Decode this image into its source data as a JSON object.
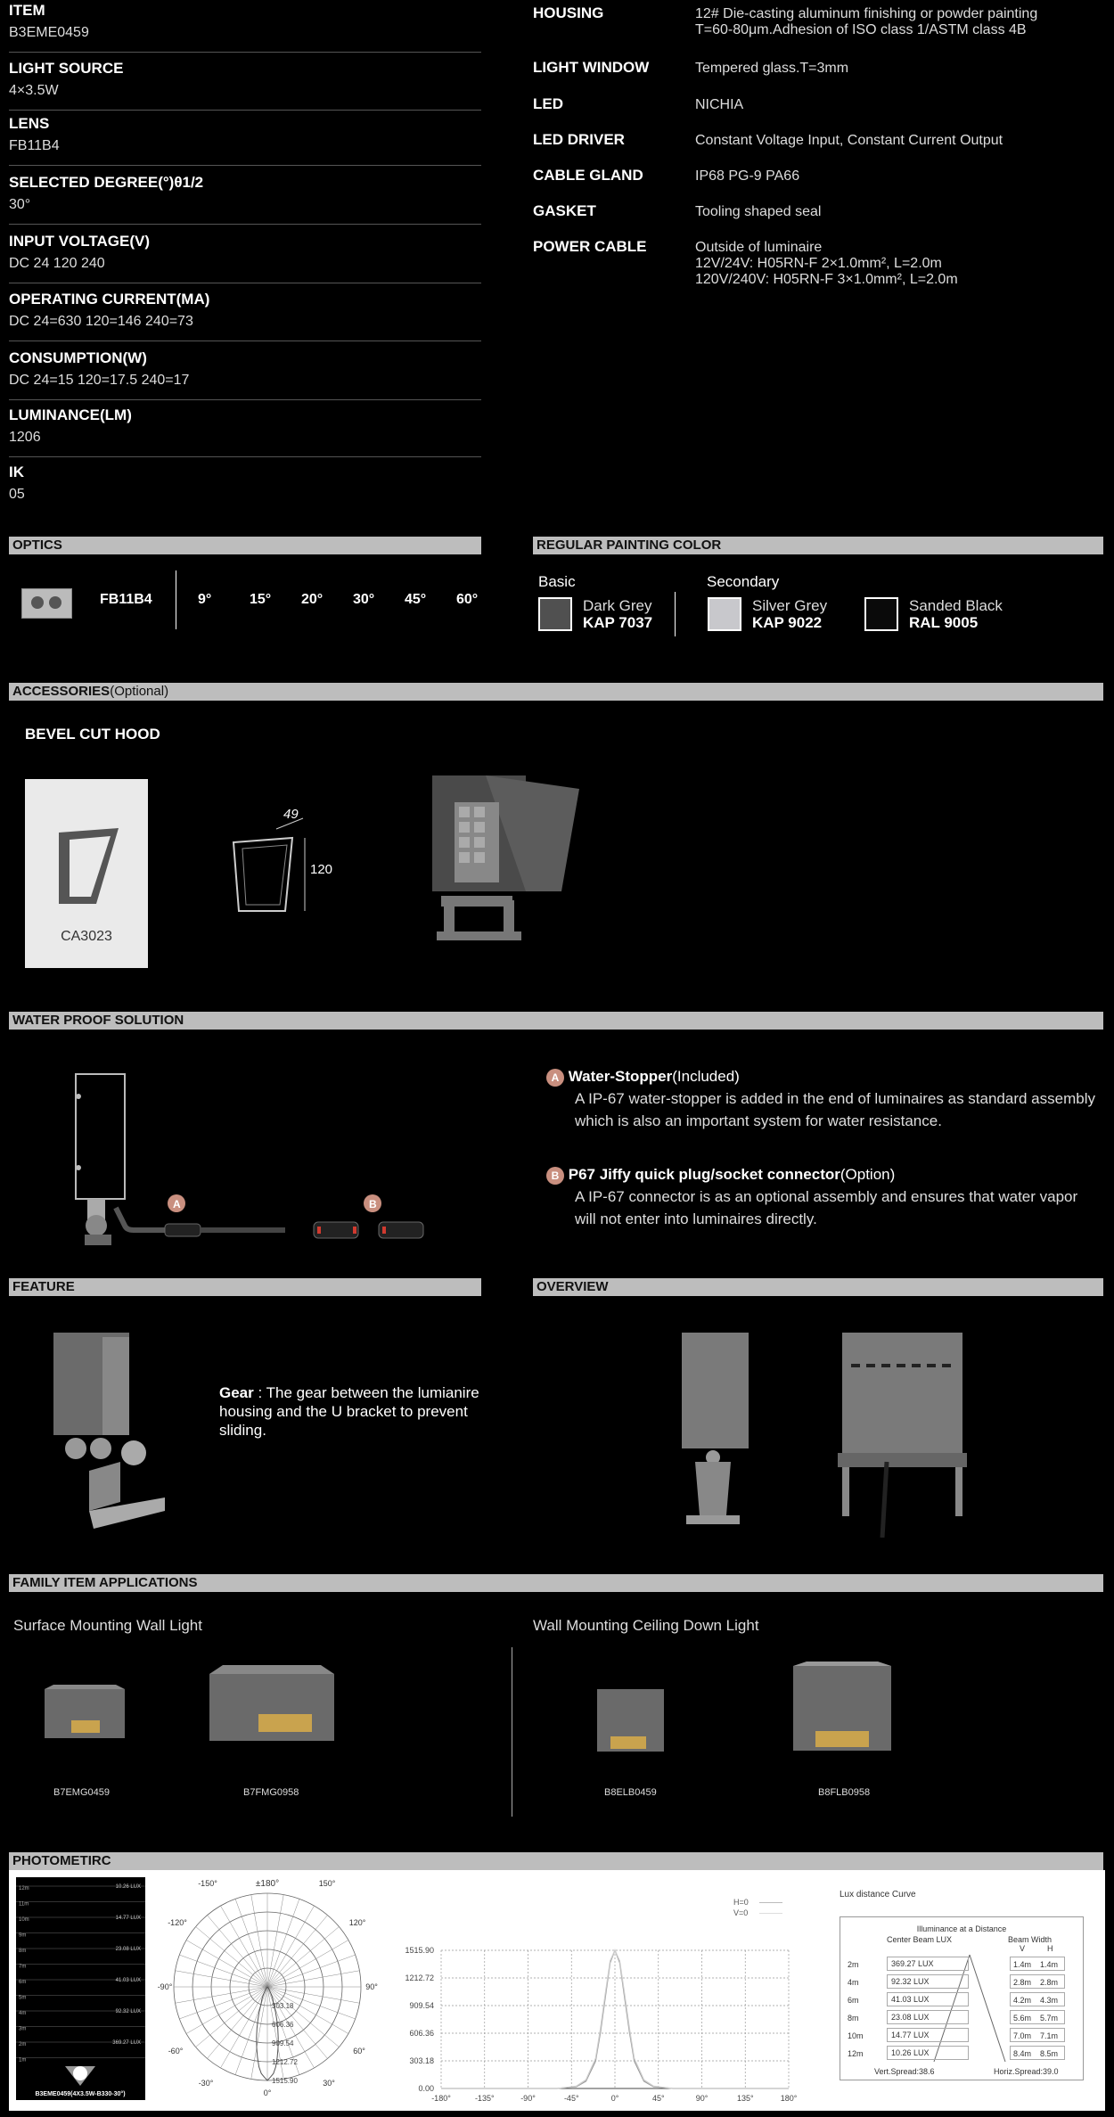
{
  "specs_left": [
    {
      "label": "ITEM",
      "value": "B3EME0459"
    },
    {
      "label": "LIGHT SOURCE",
      "value": "4×3.5W"
    },
    {
      "label": "LENS",
      "value": "FB11B4"
    },
    {
      "label": "SELECTED DEGREE(°)θ1/2",
      "value": "30°"
    },
    {
      "label": "INPUT VOLTAGE(V)",
      "value": "DC 24  120  240"
    },
    {
      "label": "OPERATING CURRENT(MA)",
      "value": "DC 24=630  120=146  240=73"
    },
    {
      "label": "CONSUMPTION(W)",
      "value": "DC 24=15  120=17.5  240=17"
    },
    {
      "label": "LUMINANCE(LM)",
      "value": "1206"
    },
    {
      "label": "IK",
      "value": "05"
    }
  ],
  "specs_right": [
    {
      "label": "HOUSING",
      "value": "12# Die-casting aluminum finishing or powder painting\nT=60-80μm.Adhesion of ISO class 1/ASTM class 4B"
    },
    {
      "label": "LIGHT WINDOW",
      "value": "Tempered glass.T=3mm"
    },
    {
      "label": "LED",
      "value": "NICHIA"
    },
    {
      "label": "LED DRIVER",
      "value": "Constant Voltage Input, Constant Current Output"
    },
    {
      "label": "CABLE GLAND",
      "value": "IP68 PG-9 PA66"
    },
    {
      "label": "GASKET",
      "value": "Tooling shaped seal"
    },
    {
      "label": "POWER CABLE",
      "value": "Outside of luminaire\n12V/24V: H05RN-F 2×1.0mm², L=2.0m\n120V/240V: H05RN-F 3×1.0mm², L=2.0m"
    }
  ],
  "optics": {
    "title": "OPTICS",
    "lens": "FB11B4",
    "degrees": [
      "9°",
      "15°",
      "20°",
      "30°",
      "45°",
      "60°"
    ]
  },
  "painting": {
    "title": "REGULAR PAINTING COLOR",
    "basic_label": "Basic",
    "secondary_label": "Secondary",
    "colors": [
      {
        "name": "Dark Grey",
        "code": "KAP 7037",
        "hex": "#505050"
      },
      {
        "name": "Silver Grey",
        "code": "KAP 9022",
        "hex": "#c8c8cc"
      },
      {
        "name": "Sanded Black",
        "code": "RAL 9005",
        "hex": "#0a0a0a"
      }
    ]
  },
  "accessories": {
    "title": "ACCESSORIES",
    "title_suffix": "(Optional)",
    "item_title": "BEVEL CUT HOOD",
    "code": "CA3023",
    "dim_width": "49",
    "dim_height": "120"
  },
  "waterproof": {
    "title": "WATER PROOF SOLUTION",
    "a_letter": "A",
    "a_title": "Water-Stopper",
    "a_suffix": "(Included)",
    "a_text": "A IP-67 water-stopper is added in the end of luminaires as standard assembly which is also an important system for water resistance.",
    "b_letter": "B",
    "b_title": "P67 Jiffy quick plug/socket connector",
    "b_suffix": "(Option)",
    "b_text": "A IP-67 connector is as an optional assembly and ensures that water vapor will not enter into luminaires directly."
  },
  "feature": {
    "title": "FEATURE",
    "gear_title": "Gear",
    "gear_text": " : The gear between the lumianire housing and the U bracket to prevent sliding."
  },
  "overview": {
    "title": "OVERVIEW"
  },
  "family": {
    "title": "FAMILY ITEM APPLICATIONS",
    "left_title": "Surface Mounting Wall Light",
    "right_title": "Wall Mounting Ceiling Down Light",
    "items": [
      "B7EMG0459",
      "B7FMG0958",
      "B8ELB0459",
      "B8FLB0958"
    ]
  },
  "photometric": {
    "title": "PHOTOMETIRC",
    "dist_rows": [
      "12m",
      "11m",
      "10m",
      "9m",
      "8m",
      "7m",
      "6m",
      "5m",
      "4m",
      "3m",
      "2m",
      "1m"
    ],
    "dist_lux": [
      "10.26 LUX",
      "14.77 LUX",
      "23.08 LUX",
      "41.03 LUX",
      "92.32 LUX",
      "369.27 LUX"
    ],
    "dist_caption": "B3EME0459(4X3.5W-B330-30°)",
    "polar_top": "±180°",
    "polar_angles": [
      "-150°",
      "150°",
      "-120°",
      "120°",
      "-90°",
      "90°",
      "-60°",
      "60°",
      "-30°",
      "30°",
      "0°"
    ],
    "polar_values": [
      "303.18",
      "606.36",
      "909.54",
      "1212.72",
      "1515.90"
    ],
    "legend_h": "H=0",
    "legend_v": "V=0",
    "lux_curve_title": "Lux distance Curve",
    "illum_title": "Illuminance at a Distance",
    "illum_center": "Center Beam LUX",
    "illum_beam": "Beam Width",
    "illum_v": "V",
    "illum_h": "H",
    "illum_rows": [
      {
        "d": "2m",
        "lux": "369.27 LUX",
        "v": "1.4m",
        "h": "1.4m"
      },
      {
        "d": "4m",
        "lux": "92.32 LUX",
        "v": "2.8m",
        "h": "2.8m"
      },
      {
        "d": "6m",
        "lux": "41.03 LUX",
        "v": "4.2m",
        "h": "4.3m"
      },
      {
        "d": "8m",
        "lux": "23.08 LUX",
        "v": "5.6m",
        "h": "5.7m"
      },
      {
        "d": "10m",
        "lux": "14.77 LUX",
        "v": "7.0m",
        "h": "7.1m"
      },
      {
        "d": "12m",
        "lux": "10.26 LUX",
        "v": "8.4m",
        "h": "8.5m"
      }
    ],
    "vert_spread": "Vert.Spread:38.6",
    "horiz_spread": "Horiz.Spread:39.0"
  },
  "chart_data": {
    "type": "line",
    "title": "",
    "xlabel": "",
    "ylabel": "",
    "xlim": [
      -180,
      180
    ],
    "ylim": [
      0,
      1515.9
    ],
    "x_ticks": [
      "-180°",
      "-135°",
      "-90°",
      "-45°",
      "0°",
      "45°",
      "90°",
      "135°",
      "180°"
    ],
    "y_ticks": [
      "0.00",
      "303.18",
      "606.36",
      "909.54",
      "1212.72",
      "1515.90"
    ],
    "series": [
      {
        "name": "H=0",
        "x": [
          -180,
          -60,
          -40,
          -30,
          -20,
          -15,
          -10,
          -5,
          0,
          5,
          10,
          15,
          20,
          30,
          40,
          60,
          180
        ],
        "values": [
          0,
          0,
          20,
          80,
          300,
          620,
          1000,
          1380,
          1515.9,
          1380,
          1000,
          620,
          300,
          80,
          20,
          0,
          0
        ]
      },
      {
        "name": "V=0",
        "x": [
          -180,
          -60,
          -40,
          -30,
          -20,
          -15,
          -10,
          -5,
          0,
          5,
          10,
          15,
          20,
          30,
          40,
          60,
          180
        ],
        "values": [
          0,
          0,
          25,
          95,
          330,
          660,
          1040,
          1400,
          1515.9,
          1400,
          1040,
          660,
          330,
          95,
          25,
          0,
          0
        ]
      }
    ]
  }
}
